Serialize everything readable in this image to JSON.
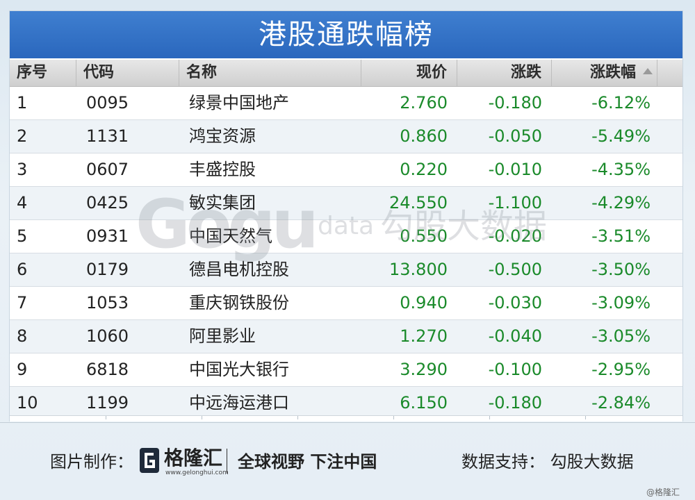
{
  "title": "港股通跌幅榜",
  "colors": {
    "title_bg": "#2f6fc7",
    "down_green": "#1a8a2a",
    "header_bg": "#d9d9d9"
  },
  "table": {
    "headers": {
      "index": "序号",
      "code": "代码",
      "name": "名称",
      "price": "现价",
      "change": "涨跌",
      "pct": "涨跌幅"
    },
    "sorted_column": "pct",
    "rows": [
      {
        "index": "1",
        "code": "0095",
        "name": "绿景中国地产",
        "price": "2.760",
        "change": "-0.180",
        "pct": "-6.12%"
      },
      {
        "index": "2",
        "code": "1131",
        "name": "鸿宝资源",
        "price": "0.860",
        "change": "-0.050",
        "pct": "-5.49%"
      },
      {
        "index": "3",
        "code": "0607",
        "name": "丰盛控股",
        "price": "0.220",
        "change": "-0.010",
        "pct": "-4.35%"
      },
      {
        "index": "4",
        "code": "0425",
        "name": "敏实集团",
        "price": "24.550",
        "change": "-1.100",
        "pct": "-4.29%"
      },
      {
        "index": "5",
        "code": "0931",
        "name": "中国天然气",
        "price": "0.550",
        "change": "-0.020",
        "pct": "-3.51%"
      },
      {
        "index": "6",
        "code": "0179",
        "name": "德昌电机控股",
        "price": "13.800",
        "change": "-0.500",
        "pct": "-3.50%"
      },
      {
        "index": "7",
        "code": "1053",
        "name": "重庆钢铁股份",
        "price": "0.940",
        "change": "-0.030",
        "pct": "-3.09%"
      },
      {
        "index": "8",
        "code": "1060",
        "name": "阿里影业",
        "price": "1.270",
        "change": "-0.040",
        "pct": "-3.05%"
      },
      {
        "index": "9",
        "code": "6818",
        "name": "中国光大银行",
        "price": "3.290",
        "change": "-0.100",
        "pct": "-2.95%"
      },
      {
        "index": "10",
        "code": "1199",
        "name": "中远海运港口",
        "price": "6.150",
        "change": "-0.180",
        "pct": "-2.84%"
      }
    ]
  },
  "watermark": {
    "logo": "Gogu",
    "data": "data",
    "cn": "勾股大数据"
  },
  "footer": {
    "made_by": "图片制作：",
    "brand": "格隆汇",
    "brand_url": "www.gelonghui.com",
    "slogan": "全球视野 下注中国",
    "support": "数据支持：  勾股大数据",
    "corner": "@格隆汇"
  }
}
